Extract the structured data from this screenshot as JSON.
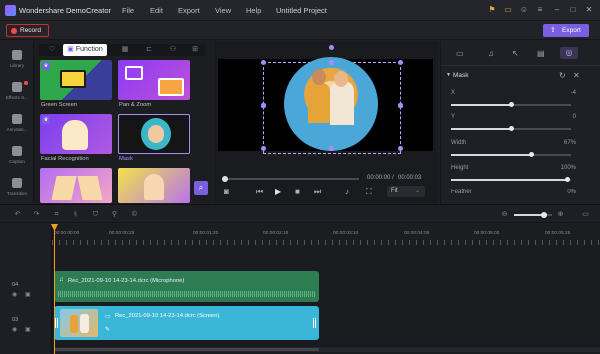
{
  "app": {
    "title": "Wondershare DemoCreator",
    "project": "Untitled Project"
  },
  "menu": [
    "File",
    "Edit",
    "Export",
    "View",
    "Help"
  ],
  "toolbar": {
    "record_label": "Record",
    "export_label": "Export"
  },
  "leftnav": [
    {
      "label": "Library",
      "icon": "library-icon"
    },
    {
      "label": "Effects S...",
      "icon": "effects-icon"
    },
    {
      "label": "Annotati...",
      "icon": "annotation-icon"
    },
    {
      "label": "Caption",
      "icon": "caption-icon"
    },
    {
      "label": "Transition",
      "icon": "transition-icon"
    }
  ],
  "library": {
    "tabs": [
      {
        "label": "",
        "icon": "heart-icon"
      },
      {
        "label": "Function",
        "icon": "function-icon",
        "active": true
      },
      {
        "label": "",
        "icon": "filter-icon"
      },
      {
        "label": "",
        "icon": "camera-icon"
      },
      {
        "label": "",
        "icon": "person-icon"
      },
      {
        "label": "",
        "icon": "grid-icon"
      }
    ],
    "cards": [
      {
        "label": "Green Screen",
        "selected": false
      },
      {
        "label": "Pan & Zoom",
        "selected": false
      },
      {
        "label": "Facial Recognition",
        "selected": false
      },
      {
        "label": "Mask",
        "selected": true
      },
      {
        "label": "",
        "selected": false
      },
      {
        "label": "",
        "selected": false
      }
    ]
  },
  "player": {
    "current": "00:00:00",
    "total": "00:00:03",
    "fit": "Fit",
    "progress": 0.0
  },
  "props": {
    "tabs": [
      "video-icon",
      "audio-icon",
      "cursor-icon",
      "caption-icon",
      "mask-icon"
    ],
    "section": "Mask",
    "rows": [
      {
        "label": "X",
        "value": "-4",
        "fraction": 0.5
      },
      {
        "label": "Y",
        "value": "0",
        "fraction": 0.5
      },
      {
        "label": "Width",
        "value": "67%",
        "fraction": 0.67
      },
      {
        "label": "Height",
        "value": "100%",
        "fraction": 0.97
      },
      {
        "label": "Feather",
        "value": "0%",
        "fraction": 0.97
      }
    ]
  },
  "timeline": {
    "ruler": [
      "00:00:00:00",
      "00:00:00:25",
      "00:00:01:20",
      "00:00:02:15",
      "00:00:03:10",
      "00:00:04:05",
      "00:00:05:00",
      "00:00:05:25"
    ],
    "zoom_fraction": 0.8,
    "tracks": [
      {
        "number": "04",
        "clip": "Rec_2021-09-10 14-23-14.dcrc (Microphone)"
      },
      {
        "number": "03",
        "clip": "Rec_2021-09-10 14-23-14.dcrc (Screen)"
      }
    ]
  },
  "colors": {
    "accent": "#7a5fe0",
    "audio_clip": "#2e7d52",
    "video_clip": "#3ab6d8",
    "record": "#ff4a4a"
  }
}
